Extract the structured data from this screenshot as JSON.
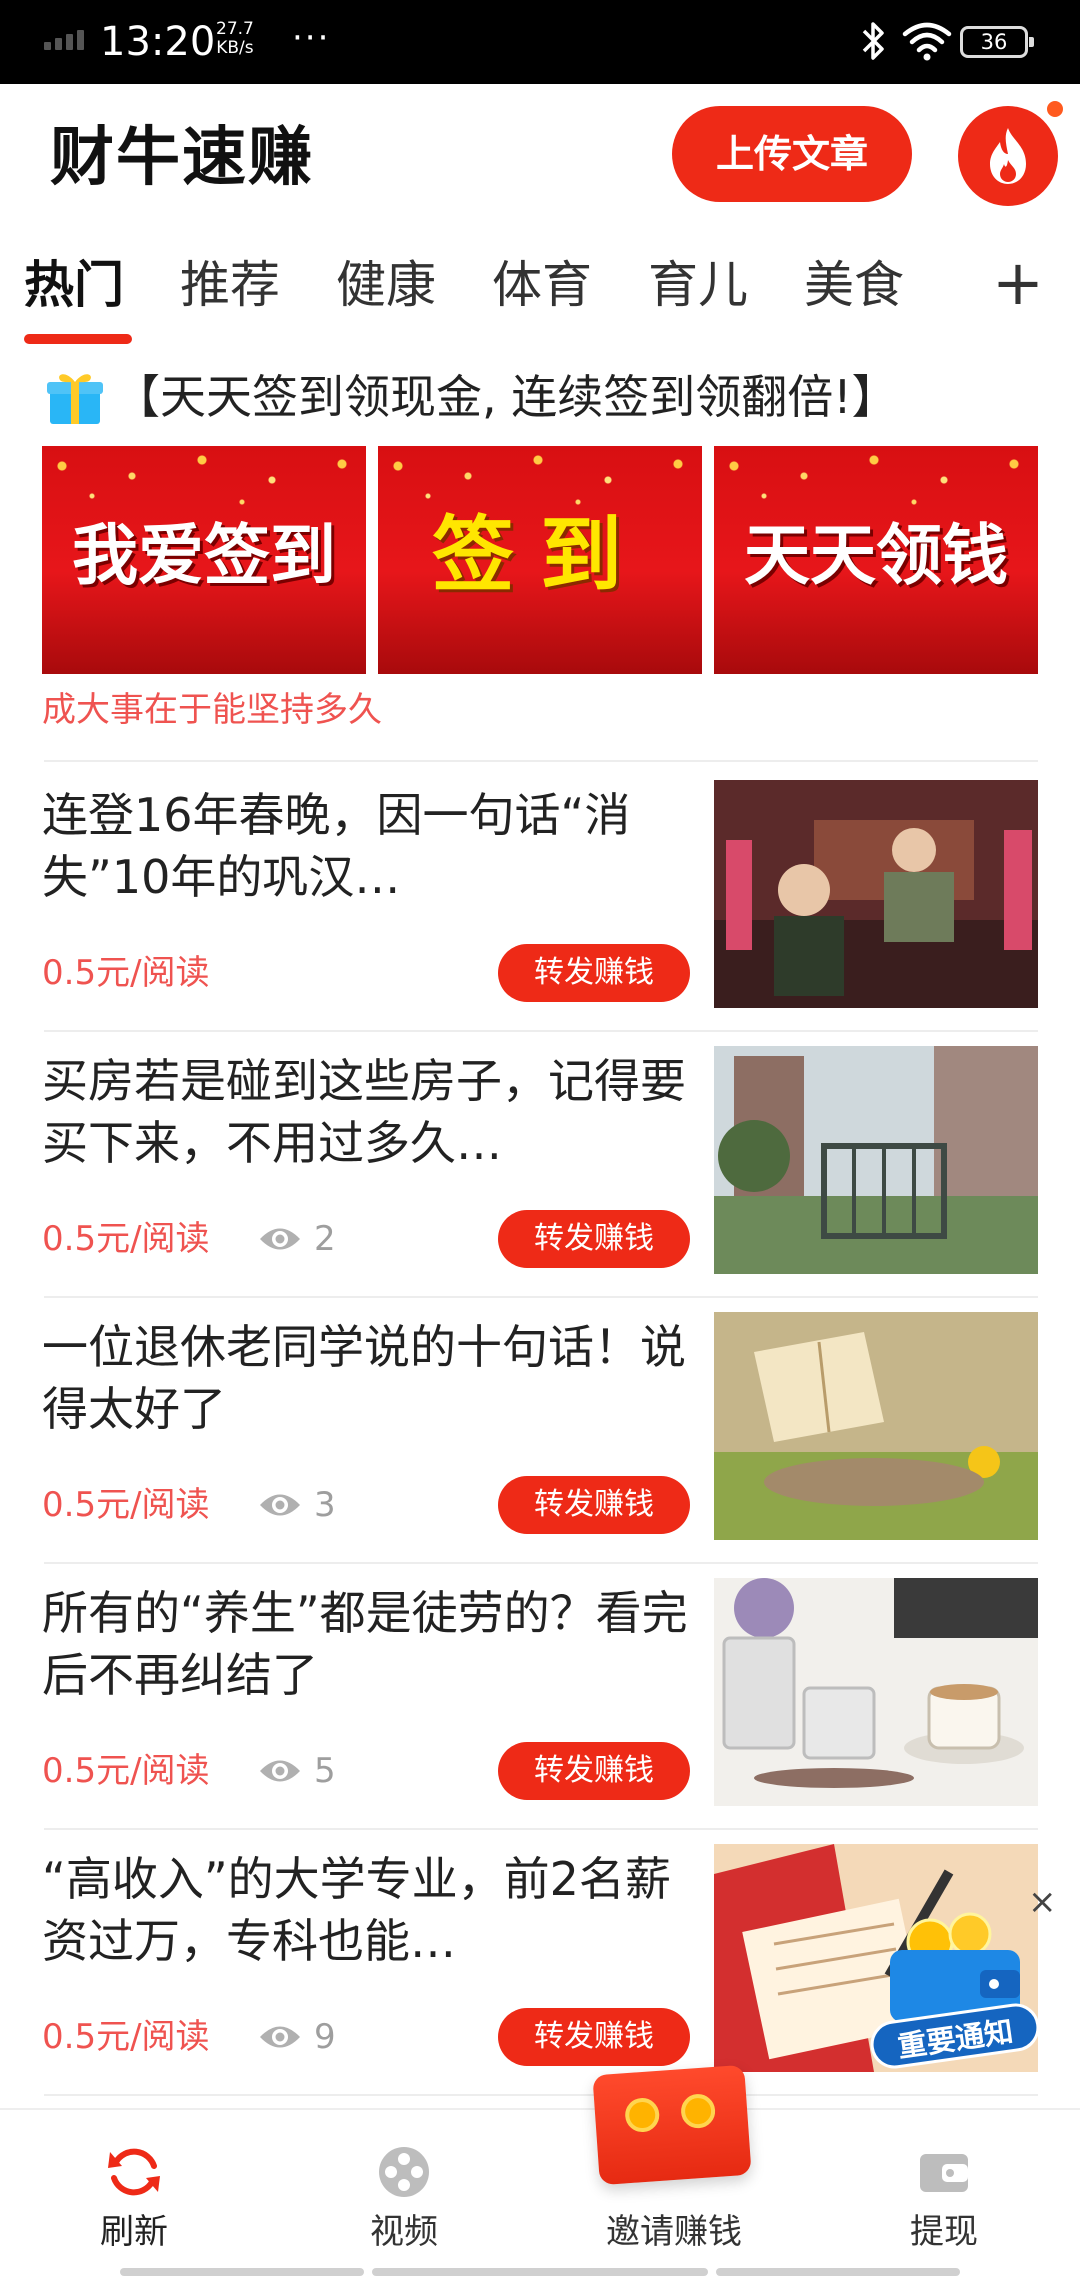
{
  "status_bar": {
    "time": "13:20",
    "net_speed_value": "27.7",
    "net_speed_unit": "KB/s",
    "dots": "···",
    "battery": "36"
  },
  "header": {
    "app_title": "财牛速赚",
    "upload_label": "上传文章",
    "fire_icon": "fire-icon",
    "accent_color": "#ee2a17"
  },
  "tabs": {
    "items": [
      {
        "label": "热门",
        "active": true
      },
      {
        "label": "推荐",
        "active": false
      },
      {
        "label": "健康",
        "active": false
      },
      {
        "label": "体育",
        "active": false
      },
      {
        "label": "育儿",
        "active": false
      },
      {
        "label": "美食",
        "active": false
      }
    ],
    "add_label": "+"
  },
  "signin_banner": {
    "title": "【天天签到领现金, 连续签到领翻倍!】",
    "images": [
      {
        "text": "我爱签到"
      },
      {
        "text": "签到"
      },
      {
        "text": "天天领钱"
      }
    ],
    "subtitle": "成大事在于能坚持多久"
  },
  "articles": [
    {
      "title": "连登16年春晚，因一句话“消失”10年的巩汉…",
      "price": "0.5元/阅读",
      "views": "",
      "share_label": "转发赚钱"
    },
    {
      "title": "买房若是碰到这些房子，记得要买下来，不用过多久…",
      "price": "0.5元/阅读",
      "views": "2",
      "share_label": "转发赚钱"
    },
    {
      "title": "一位退休老同学说的十句话！说得太好了",
      "price": "0.5元/阅读",
      "views": "3",
      "share_label": "转发赚钱"
    },
    {
      "title": "所有的“养生”都是徒劳的？看完后不再纠结了",
      "price": "0.5元/阅读",
      "views": "5",
      "share_label": "转发赚钱"
    },
    {
      "title": "“高收入”的大学专业，前2名薪资过万，专科也能…",
      "price": "0.5元/阅读",
      "views": "9",
      "share_label": "转发赚钱"
    }
  ],
  "floating": {
    "close_label": "×",
    "notice_label": "重要通知"
  },
  "bottom_nav": {
    "items": [
      {
        "label": "刷新",
        "icon": "refresh-icon"
      },
      {
        "label": "视频",
        "icon": "video-icon"
      },
      {
        "label": "邀请赚钱",
        "icon": "red-packet-icon"
      },
      {
        "label": "提现",
        "icon": "wallet-icon"
      }
    ]
  }
}
